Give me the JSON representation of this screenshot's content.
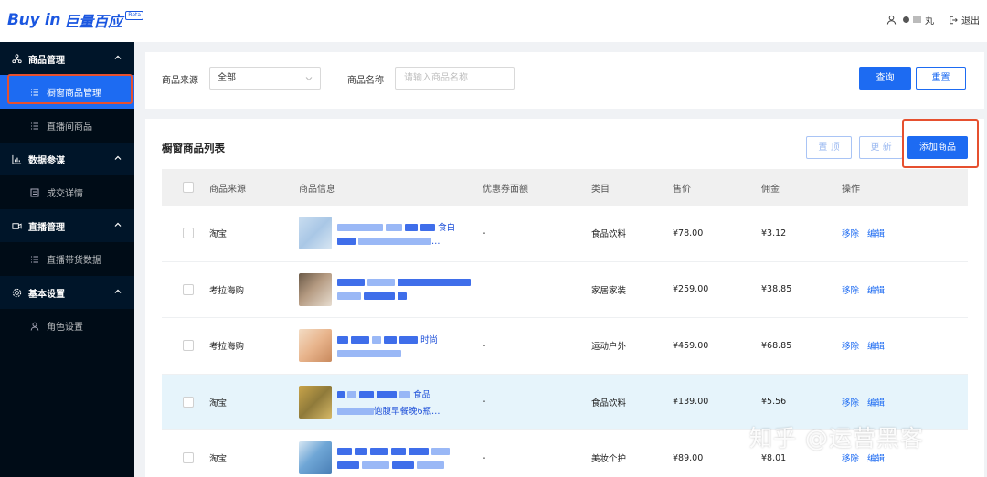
{
  "header": {
    "logo_en": "Buy in",
    "logo_cn": "巨量百应",
    "logo_badge": "Beta",
    "user_name": "丸",
    "logout_label": "退出"
  },
  "sidebar": {
    "groups": [
      {
        "label": "商品管理",
        "icon": "product-icon",
        "items": [
          {
            "label": "橱窗商品管理",
            "active": true
          },
          {
            "label": "直播间商品",
            "active": false
          }
        ]
      },
      {
        "label": "数据参谋",
        "icon": "chart-icon",
        "items": [
          {
            "label": "成交详情",
            "active": false
          }
        ]
      },
      {
        "label": "直播管理",
        "icon": "video-icon",
        "items": [
          {
            "label": "直播带货数据",
            "active": false
          }
        ]
      },
      {
        "label": "基本设置",
        "icon": "settings-icon",
        "items": [
          {
            "label": "角色设置",
            "active": false
          }
        ]
      }
    ]
  },
  "filter": {
    "source_label": "商品来源",
    "source_value": "全部",
    "name_label": "商品名称",
    "name_placeholder": "请输入商品名称",
    "query_button": "查询",
    "reset_button": "重置"
  },
  "list": {
    "title": "橱窗商品列表",
    "pin_button": "置 顶",
    "update_button": "更 新",
    "add_button": "添加商品",
    "columns": [
      "商品来源",
      "商品信息",
      "优惠券面额",
      "类目",
      "售价",
      "佣金",
      "操作"
    ],
    "rows": [
      {
        "source": "淘宝",
        "title_visible": "食白",
        "subtitle_visible": "…",
        "coupon": "-",
        "category": "食品饮料",
        "price": "¥78.00",
        "commission": "¥3.12",
        "thumb_color": "#a9c7e6",
        "highlight": false
      },
      {
        "source": "考拉海购",
        "title_visible": "",
        "subtitle_visible": "",
        "coupon": "",
        "category": "家居家装",
        "price": "¥259.00",
        "commission": "¥38.85",
        "thumb_color": "#b59b82",
        "highlight": false
      },
      {
        "source": "考拉海购",
        "title_visible": "时尚",
        "subtitle_visible": "",
        "coupon": "-",
        "category": "运动户外",
        "price": "¥459.00",
        "commission": "¥68.85",
        "thumb_color": "#e8b48c",
        "highlight": false
      },
      {
        "source": "淘宝",
        "title_visible": "食品",
        "subtitle_visible": "饱腹早餐晚6瓶…",
        "coupon": "-",
        "category": "食品饮料",
        "price": "¥139.00",
        "commission": "¥5.56",
        "thumb_color": "#8f7a3a",
        "highlight": true
      },
      {
        "source": "淘宝",
        "title_visible": "",
        "subtitle_visible": "",
        "coupon": "-",
        "category": "美妆个护",
        "price": "¥89.00",
        "commission": "¥8.01",
        "thumb_color": "#6fa6d6",
        "highlight": false
      }
    ],
    "op_remove": "移除",
    "op_edit": "编辑"
  },
  "watermark": "知乎 @运营黑客",
  "colors": {
    "primary": "#1d6bf2",
    "sidebar_bg": "#001529",
    "highlight_outline": "#e6502f",
    "row_highlight": "#e6f4fb"
  }
}
